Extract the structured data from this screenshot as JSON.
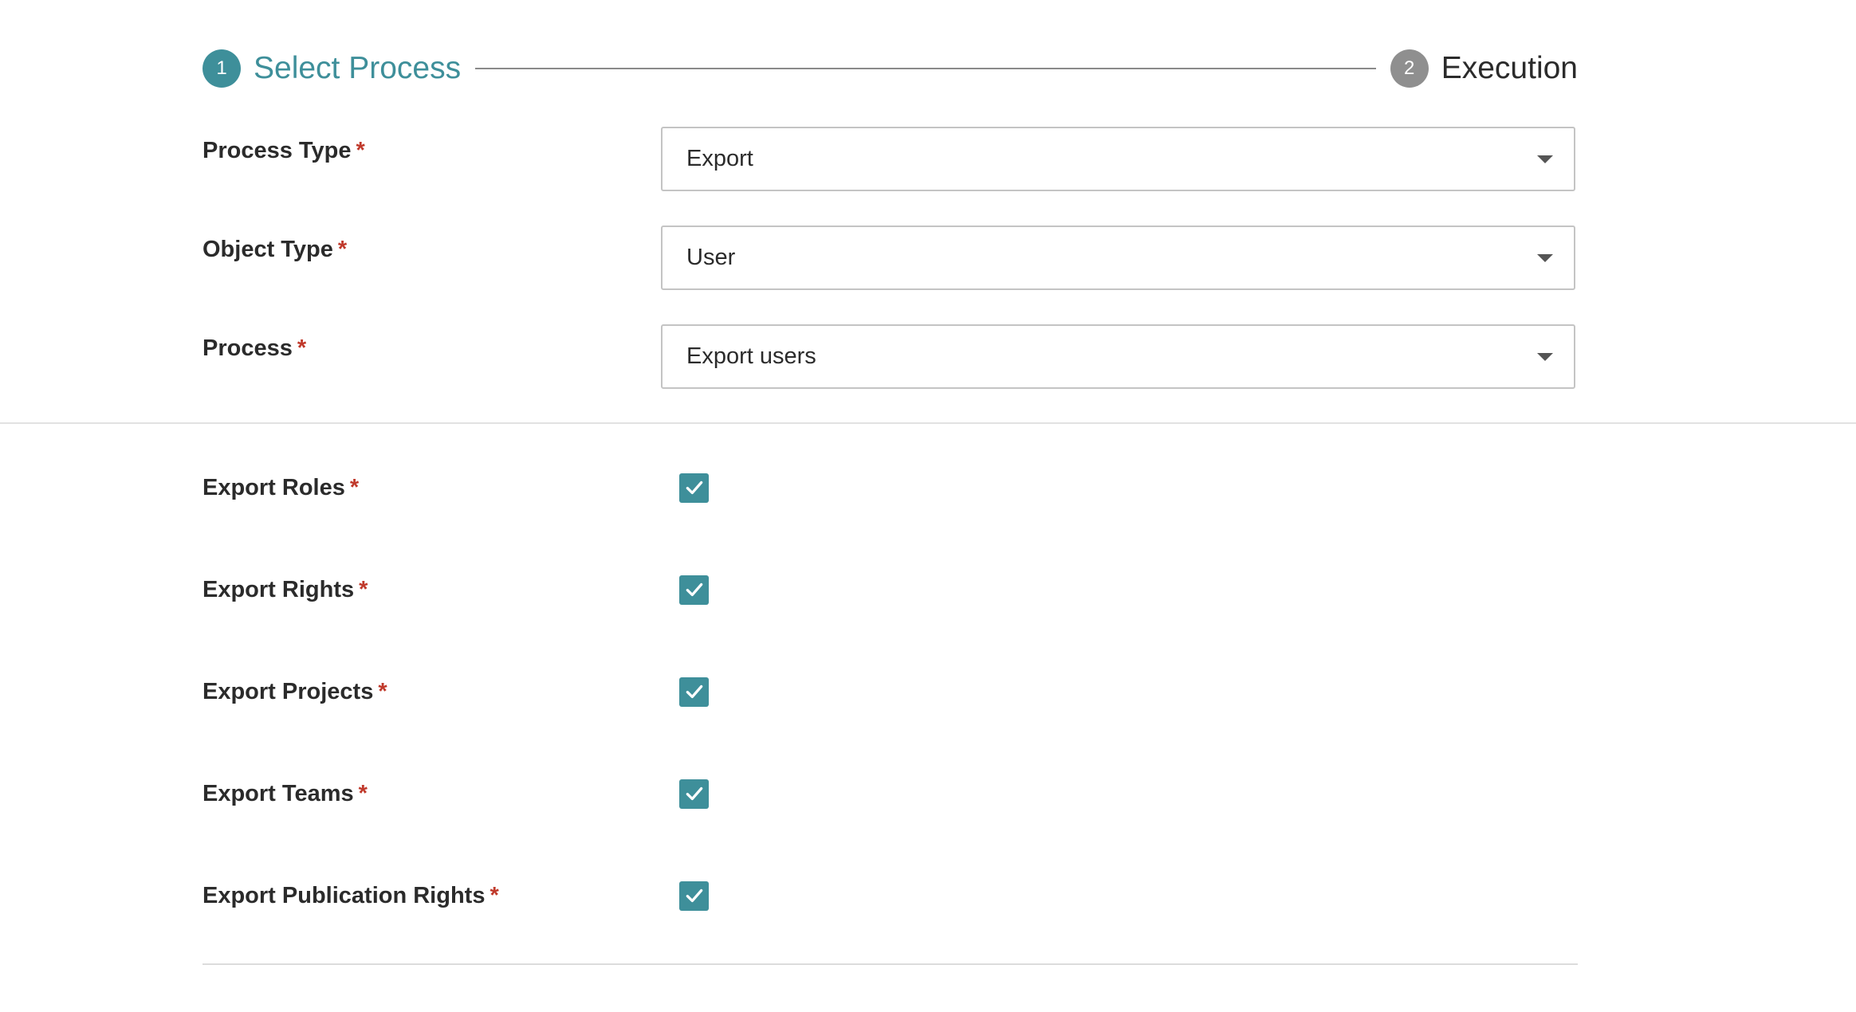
{
  "stepper": {
    "steps": [
      {
        "number": "1",
        "label": "Select Process",
        "state": "active"
      },
      {
        "number": "2",
        "label": "Execution",
        "state": "inactive"
      }
    ]
  },
  "form": {
    "process_type": {
      "label": "Process Type",
      "required_mark": "*",
      "value": "Export"
    },
    "object_type": {
      "label": "Object Type",
      "required_mark": "*",
      "value": "User"
    },
    "process": {
      "label": "Process",
      "required_mark": "*",
      "value": "Export users"
    }
  },
  "options": [
    {
      "label": "Export Roles",
      "required_mark": "*",
      "checked": true
    },
    {
      "label": "Export Rights",
      "required_mark": "*",
      "checked": true
    },
    {
      "label": "Export Projects",
      "required_mark": "*",
      "checked": true
    },
    {
      "label": "Export Teams",
      "required_mark": "*",
      "checked": true
    },
    {
      "label": "Export Publication Rights",
      "required_mark": "*",
      "checked": true
    }
  ],
  "colors": {
    "accent": "#3e8f9a",
    "inactive_step": "#8f8f8f",
    "required": "#c0392b"
  },
  "icons": {
    "select_caret": "chevron-down-icon",
    "checkbox_mark": "checkmark-icon"
  }
}
